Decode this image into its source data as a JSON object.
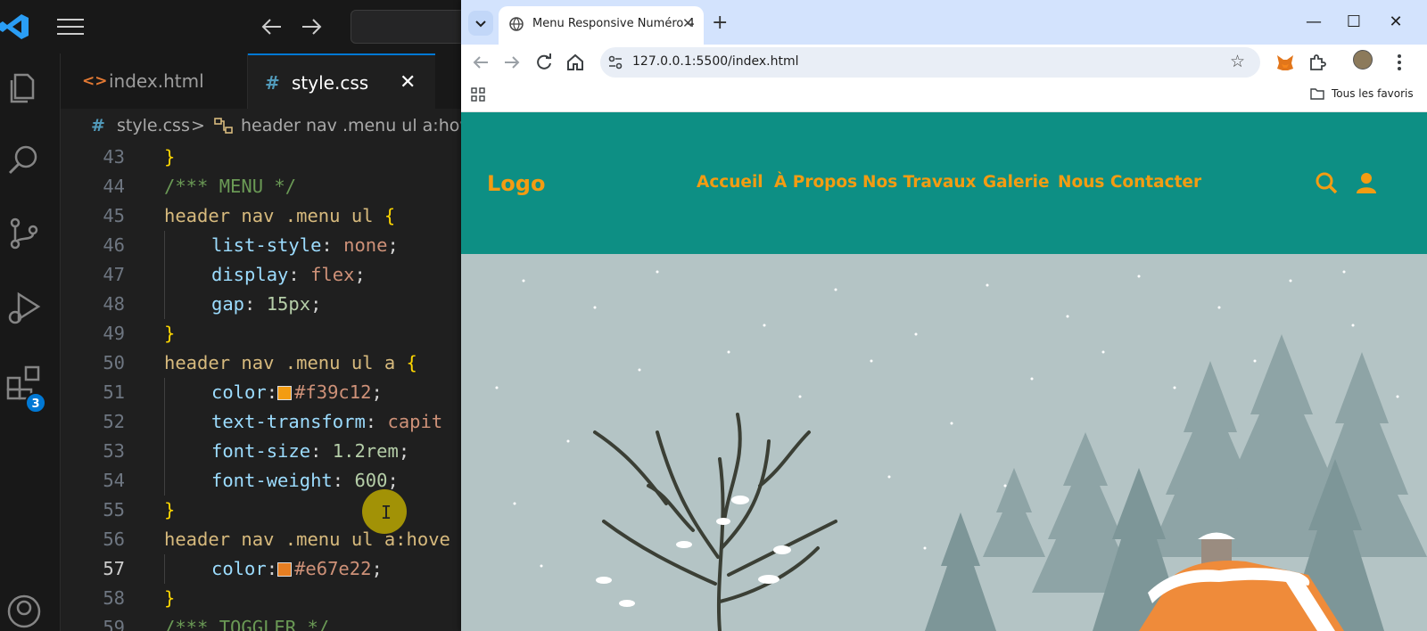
{
  "vscode": {
    "badge_count": "3",
    "tabs": [
      {
        "icon": "<>",
        "label": "index.html"
      },
      {
        "icon": "#",
        "label": "style.css",
        "close": "✕"
      }
    ],
    "breadcrumb": {
      "hash": "#",
      "file": "style.css",
      "separator": ">",
      "rule": "header nav .menu ul a:hov"
    },
    "editor_lines": [
      {
        "n": "43",
        "text": "}"
      },
      {
        "n": "44",
        "text": "/*** MENU */"
      },
      {
        "n": "45",
        "text": "header nav .menu ul {"
      },
      {
        "n": "46",
        "text": "    list-style: none;"
      },
      {
        "n": "47",
        "text": "    display: flex;"
      },
      {
        "n": "48",
        "text": "    gap: 15px;"
      },
      {
        "n": "49",
        "text": "}"
      },
      {
        "n": "50",
        "text": "header nav .menu ul a {"
      },
      {
        "n": "51",
        "text": "    color: #f39c12;"
      },
      {
        "n": "52",
        "text": "    text-transform: capit"
      },
      {
        "n": "53",
        "text": "    font-size: 1.2rem;"
      },
      {
        "n": "54",
        "text": "    font-weight: 600;"
      },
      {
        "n": "55",
        "text": "}"
      },
      {
        "n": "56",
        "text": "header nav .menu ul a:hov"
      },
      {
        "n": "57",
        "text": "    color: #e67e22;"
      },
      {
        "n": "58",
        "text": "}"
      },
      {
        "n": "59",
        "text": "/*** TOGGLER */"
      }
    ],
    "current_line": "57",
    "code": {
      "l43": {
        "brace": "}"
      },
      "l44": {
        "comment": "/*** MENU */"
      },
      "l45": {
        "selector": "header nav .menu ul ",
        "brace": "{"
      },
      "l46": {
        "prop": "list-style",
        "colon": ": ",
        "value": "none",
        "semi": ";"
      },
      "l47": {
        "prop": "display",
        "colon": ": ",
        "value": "flex",
        "semi": ";"
      },
      "l48": {
        "prop": "gap",
        "colon": ": ",
        "value": "15px",
        "semi": ";"
      },
      "l49": {
        "brace": "}"
      },
      "l50": {
        "selector": "header nav .menu ul a ",
        "brace": "{"
      },
      "l51": {
        "prop": "color",
        "colon": ":",
        "value": "#f39c12",
        "semi": ";",
        "swatch": "#f39c12"
      },
      "l52": {
        "prop": "text-transform",
        "colon": ": ",
        "value": "capit"
      },
      "l53": {
        "prop": "font-size",
        "colon": ": ",
        "value": "1.2rem",
        "semi": ";"
      },
      "l54": {
        "prop": "font-weight",
        "colon": ": ",
        "value": "600",
        "semi": ";"
      },
      "l55": {
        "brace": "}"
      },
      "l56": {
        "selector": "header nav .menu ul a:hove"
      },
      "l57": {
        "prop": "color",
        "colon": ":",
        "value": "#e67e22",
        "semi": ";",
        "swatch": "#e67e22"
      },
      "l58": {
        "brace": "}"
      },
      "l59": {
        "comment": "/*** TOGGLER */"
      }
    },
    "cursor_glyph": "I",
    "icons": [
      "vscode-logo-icon",
      "menu-icon",
      "arrow-left-icon",
      "arrow-right-icon",
      "explorer-icon",
      "search-icon",
      "source-control-icon",
      "run-debug-icon",
      "extensions-icon",
      "accounts-icon",
      "symbol-icon"
    ]
  },
  "browser": {
    "tab_title": "Menu Responsive Numéro 4",
    "tab_close": "✕",
    "new_tab": "+",
    "window_buttons": [
      "—",
      "☐",
      "✕"
    ],
    "url": "127.0.0.1:5500/index.html",
    "star": "☆",
    "bookmark_folder": "Tous les favoris",
    "icons": [
      "tab-search-icon",
      "globe-icon",
      "back-icon",
      "forward-icon",
      "reload-icon",
      "home-icon",
      "site-info-icon",
      "metamask-fox-icon",
      "extensions-puzzle-icon",
      "profile-avatar-icon",
      "kebab-menu-icon",
      "apps-grid-icon",
      "folder-icon"
    ]
  },
  "site": {
    "logo": "Logo",
    "menu": [
      "Accueil",
      "À Propos",
      "Nos Travaux",
      "Galerie",
      "Nous Contacter"
    ],
    "icons": [
      "search-icon",
      "user-icon"
    ]
  },
  "colors": {
    "vscode_bg": "#1f1f1f",
    "accent_blue": "#0078d4",
    "site_header": "#0d8f84",
    "menu_link": "#f39c12",
    "menu_hover": "#e67e22",
    "hero_sky": "#b4c4c5"
  }
}
